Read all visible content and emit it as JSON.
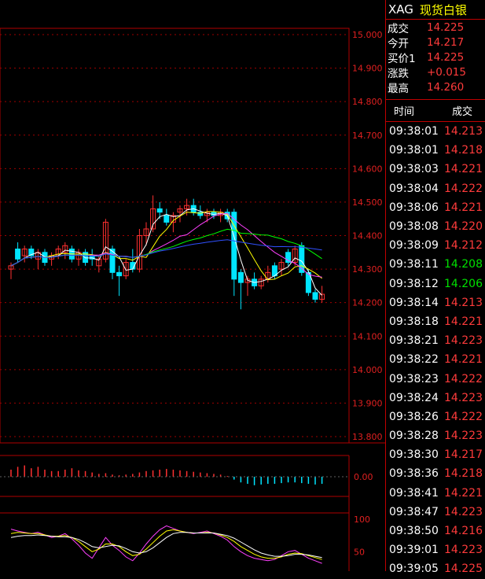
{
  "panel": {
    "code": "XAG",
    "name": "现货白银",
    "quote": [
      {
        "label": "成交",
        "value": "14.225"
      },
      {
        "label": "今开",
        "value": "14.217"
      },
      {
        "label": "买价1",
        "value": "14.225"
      },
      {
        "label": "涨跌",
        "value": "+0.015"
      },
      {
        "label": "最高",
        "value": "14.260"
      }
    ],
    "tick_header": {
      "time": "时间",
      "price": "成交"
    },
    "ticks": [
      {
        "time": "09:38:01",
        "price": "14.213",
        "dir": "up"
      },
      {
        "time": "09:38:01",
        "price": "14.218",
        "dir": "up"
      },
      {
        "time": "09:38:03",
        "price": "14.221",
        "dir": "up"
      },
      {
        "time": "09:38:04",
        "price": "14.222",
        "dir": "up"
      },
      {
        "time": "09:38:06",
        "price": "14.221",
        "dir": "up"
      },
      {
        "time": "09:38:08",
        "price": "14.220",
        "dir": "up"
      },
      {
        "time": "09:38:09",
        "price": "14.212",
        "dir": "up"
      },
      {
        "time": "09:38:11",
        "price": "14.208",
        "dir": "down"
      },
      {
        "time": "09:38:12",
        "price": "14.206",
        "dir": "down"
      },
      {
        "time": "09:38:14",
        "price": "14.213",
        "dir": "up"
      },
      {
        "time": "09:38:18",
        "price": "14.221",
        "dir": "up"
      },
      {
        "time": "09:38:21",
        "price": "14.223",
        "dir": "up"
      },
      {
        "time": "09:38:22",
        "price": "14.221",
        "dir": "up"
      },
      {
        "time": "09:38:23",
        "price": "14.222",
        "dir": "up"
      },
      {
        "time": "09:38:24",
        "price": "14.223",
        "dir": "up"
      },
      {
        "time": "09:38:26",
        "price": "14.222",
        "dir": "up"
      },
      {
        "time": "09:38:28",
        "price": "14.223",
        "dir": "up"
      },
      {
        "time": "09:38:30",
        "price": "14.217",
        "dir": "up"
      },
      {
        "time": "09:38:36",
        "price": "14.218",
        "dir": "up"
      },
      {
        "time": "09:38:41",
        "price": "14.221",
        "dir": "up"
      },
      {
        "time": "09:38:47",
        "price": "14.223",
        "dir": "up"
      },
      {
        "time": "09:38:50",
        "price": "14.216",
        "dir": "up"
      },
      {
        "time": "09:39:01",
        "price": "14.223",
        "dir": "up"
      },
      {
        "time": "09:39:05",
        "price": "14.225",
        "dir": "up"
      }
    ]
  },
  "chart_data": [
    {
      "type": "candlestick",
      "ylim": [
        13.8,
        15.0
      ],
      "yticks": [
        "15.000",
        "14.900",
        "14.800",
        "14.700",
        "14.600",
        "14.500",
        "14.400",
        "14.300",
        "14.200",
        "14.100",
        "14.000",
        "13.900",
        "13.800"
      ],
      "grid": true,
      "colors": {
        "up": "#ff3030",
        "down": "#00e5ff",
        "ma5": "#ffffff",
        "ma10": "#ffff00",
        "ma20": "#ff40ff",
        "ma30": "#00ff00",
        "ma60": "#3050ff"
      },
      "candles": [
        {
          "o": 14.3,
          "h": 14.32,
          "l": 14.27,
          "c": 14.31
        },
        {
          "o": 14.36,
          "h": 14.38,
          "l": 14.32,
          "c": 14.33
        },
        {
          "o": 14.34,
          "h": 14.37,
          "l": 14.32,
          "c": 14.36
        },
        {
          "o": 14.36,
          "h": 14.37,
          "l": 14.33,
          "c": 14.34
        },
        {
          "o": 14.33,
          "h": 14.36,
          "l": 14.3,
          "c": 14.35
        },
        {
          "o": 14.35,
          "h": 14.36,
          "l": 14.31,
          "c": 14.32
        },
        {
          "o": 14.33,
          "h": 14.35,
          "l": 14.31,
          "c": 14.34
        },
        {
          "o": 14.34,
          "h": 14.37,
          "l": 14.33,
          "c": 14.36
        },
        {
          "o": 14.35,
          "h": 14.38,
          "l": 14.33,
          "c": 14.37
        },
        {
          "o": 14.36,
          "h": 14.37,
          "l": 14.32,
          "c": 14.33
        },
        {
          "o": 14.33,
          "h": 14.36,
          "l": 14.31,
          "c": 14.35
        },
        {
          "o": 14.35,
          "h": 14.36,
          "l": 14.31,
          "c": 14.32
        },
        {
          "o": 14.34,
          "h": 14.36,
          "l": 14.31,
          "c": 14.33
        },
        {
          "o": 14.31,
          "h": 14.34,
          "l": 14.29,
          "c": 14.33
        },
        {
          "o": 14.33,
          "h": 14.45,
          "l": 14.32,
          "c": 14.44
        },
        {
          "o": 14.36,
          "h": 14.37,
          "l": 14.27,
          "c": 14.29
        },
        {
          "o": 14.29,
          "h": 14.31,
          "l": 14.22,
          "c": 14.28
        },
        {
          "o": 14.28,
          "h": 14.33,
          "l": 14.27,
          "c": 14.32
        },
        {
          "o": 14.32,
          "h": 14.36,
          "l": 14.29,
          "c": 14.3
        },
        {
          "o": 14.3,
          "h": 14.42,
          "l": 14.29,
          "c": 14.4
        },
        {
          "o": 14.4,
          "h": 14.44,
          "l": 14.37,
          "c": 14.42
        },
        {
          "o": 14.42,
          "h": 14.52,
          "l": 14.41,
          "c": 14.48
        },
        {
          "o": 14.48,
          "h": 14.5,
          "l": 14.45,
          "c": 14.47
        },
        {
          "o": 14.46,
          "h": 14.48,
          "l": 14.43,
          "c": 14.44
        },
        {
          "o": 14.44,
          "h": 14.47,
          "l": 14.41,
          "c": 14.46
        },
        {
          "o": 14.47,
          "h": 14.49,
          "l": 14.44,
          "c": 14.48
        },
        {
          "o": 14.48,
          "h": 14.51,
          "l": 14.46,
          "c": 14.49
        },
        {
          "o": 14.49,
          "h": 14.51,
          "l": 14.46,
          "c": 14.47
        },
        {
          "o": 14.47,
          "h": 14.49,
          "l": 14.45,
          "c": 14.46
        },
        {
          "o": 14.46,
          "h": 14.48,
          "l": 14.44,
          "c": 14.47
        },
        {
          "o": 14.47,
          "h": 14.48,
          "l": 14.45,
          "c": 14.46
        },
        {
          "o": 14.46,
          "h": 14.48,
          "l": 14.44,
          "c": 14.47
        },
        {
          "o": 14.47,
          "h": 14.48,
          "l": 14.44,
          "c": 14.45
        },
        {
          "o": 14.47,
          "h": 14.48,
          "l": 14.22,
          "c": 14.27
        },
        {
          "o": 14.29,
          "h": 14.3,
          "l": 14.18,
          "c": 14.26
        },
        {
          "o": 14.26,
          "h": 14.28,
          "l": 14.22,
          "c": 14.27
        },
        {
          "o": 14.27,
          "h": 14.29,
          "l": 14.24,
          "c": 14.25
        },
        {
          "o": 14.25,
          "h": 14.28,
          "l": 14.24,
          "c": 14.27
        },
        {
          "o": 14.27,
          "h": 14.31,
          "l": 14.26,
          "c": 14.29
        },
        {
          "o": 14.31,
          "h": 14.32,
          "l": 14.27,
          "c": 14.28
        },
        {
          "o": 14.3,
          "h": 14.33,
          "l": 14.28,
          "c": 14.32
        },
        {
          "o": 14.35,
          "h": 14.36,
          "l": 14.31,
          "c": 14.32
        },
        {
          "o": 14.32,
          "h": 14.37,
          "l": 14.31,
          "c": 14.36
        },
        {
          "o": 14.37,
          "h": 14.38,
          "l": 14.28,
          "c": 14.29
        },
        {
          "o": 14.29,
          "h": 14.3,
          "l": 14.22,
          "c": 14.23
        },
        {
          "o": 14.23,
          "h": 14.24,
          "l": 14.2,
          "c": 14.21
        },
        {
          "o": 14.21,
          "h": 14.25,
          "l": 14.2,
          "c": 14.225
        }
      ]
    },
    {
      "type": "bar",
      "yticks": [
        "0.00"
      ],
      "values": [
        0.01,
        0.014,
        0.016,
        0.012,
        0.014,
        0.01,
        0.008,
        0.008,
        0.01,
        0.012,
        0.009,
        0.008,
        0.006,
        0.004,
        0.005,
        0.003,
        0.002,
        0.003,
        0.004,
        0.006,
        0.008,
        0.009,
        0.01,
        0.011,
        0.01,
        0.009,
        0.008,
        0.007,
        0.006,
        0.005,
        0.004,
        0.003,
        0.001,
        -0.004,
        -0.008,
        -0.01,
        -0.012,
        -0.011,
        -0.01,
        -0.01,
        -0.009,
        -0.008,
        -0.008,
        -0.009,
        -0.01,
        -0.011,
        -0.01
      ]
    },
    {
      "type": "line",
      "yticks": [
        "100",
        "50"
      ],
      "ylim": [
        20,
        110
      ],
      "series": [
        {
          "values": [
            85,
            82,
            80,
            78,
            80,
            76,
            72,
            74,
            78,
            70,
            60,
            48,
            40,
            56,
            72,
            60,
            52,
            42,
            36,
            48,
            62,
            74,
            84,
            90,
            86,
            82,
            80,
            78,
            80,
            82,
            78,
            74,
            68,
            58,
            50,
            44,
            40,
            38,
            36,
            38,
            44,
            50,
            52,
            46,
            40,
            36,
            32
          ]
        },
        {
          "values": [
            78,
            80,
            79,
            78,
            78,
            76,
            74,
            74,
            75,
            72,
            66,
            58,
            50,
            54,
            62,
            62,
            58,
            50,
            44,
            46,
            54,
            64,
            74,
            82,
            84,
            82,
            80,
            79,
            79,
            80,
            79,
            76,
            72,
            66,
            58,
            52,
            46,
            42,
            40,
            40,
            42,
            46,
            48,
            47,
            44,
            41,
            38
          ]
        },
        {
          "values": [
            72,
            74,
            75,
            75,
            76,
            75,
            74,
            73,
            73,
            72,
            69,
            64,
            58,
            56,
            58,
            60,
            59,
            55,
            50,
            48,
            50,
            56,
            64,
            72,
            78,
            80,
            80,
            79,
            79,
            79,
            79,
            77,
            75,
            71,
            65,
            59,
            53,
            48,
            45,
            43,
            43,
            44,
            46,
            46,
            45,
            43,
            41
          ]
        }
      ]
    }
  ]
}
